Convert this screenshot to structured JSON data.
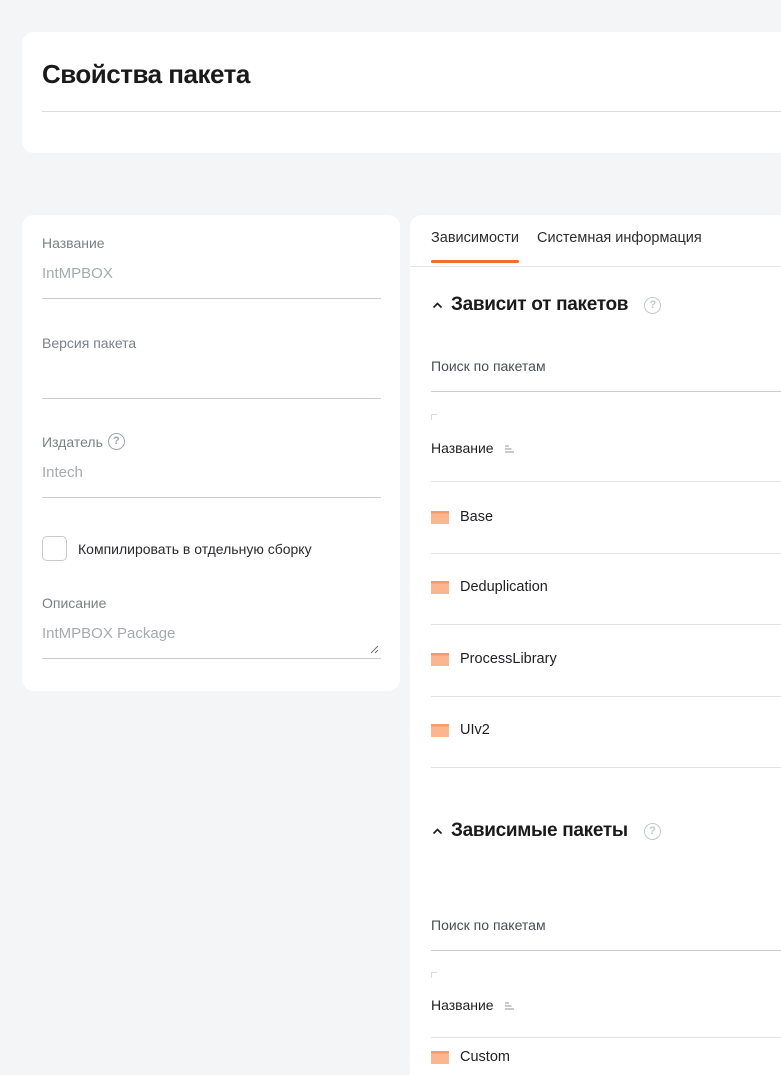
{
  "header": {
    "title": "Свойства пакета"
  },
  "form": {
    "name_label": "Название",
    "name_value": "IntMPBOX",
    "version_label": "Версия пакета",
    "version_value": "",
    "publisher_label": "Издатель",
    "publisher_value": "Intech",
    "compile_label": "Компилировать в отдельную сборку",
    "compile_checked": false,
    "description_label": "Описание",
    "description_value": "IntMPBOX Package"
  },
  "tabs": [
    {
      "label": "Зависимости",
      "active": true
    },
    {
      "label": "Системная информация",
      "active": false
    }
  ],
  "depends_on": {
    "title": "Зависит от пакетов",
    "search_placeholder": "Поиск по пакетам",
    "column_name": "Название",
    "packages": [
      "Base",
      "Deduplication",
      "ProcessLibrary",
      "UIv2"
    ]
  },
  "dependents": {
    "title": "Зависимые пакеты",
    "search_placeholder": "Поиск по пакетам",
    "column_name": "Название",
    "packages": [
      "Custom"
    ]
  },
  "colors": {
    "accent": "#f26c37",
    "folder": "#fbb58f",
    "background": "#f4f5f7"
  },
  "icons": {
    "help": "question-circle-icon",
    "chevron": "chevron-up-icon",
    "sort": "sort-icon",
    "folder": "folder-icon",
    "resize": "resize-handle-icon"
  }
}
